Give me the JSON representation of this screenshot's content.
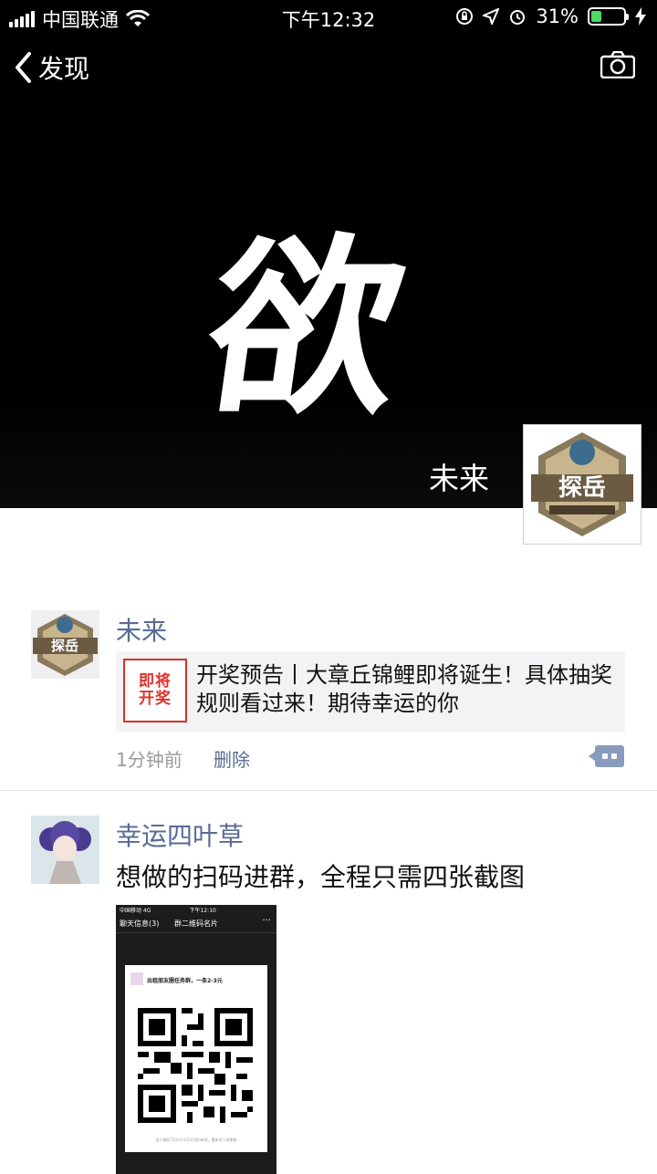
{
  "status_bar": {
    "carrier": "中国联通",
    "time": "下午12:32",
    "battery_pct": "31%",
    "battery_level": 0.31,
    "battery_color": "#4cd964"
  },
  "nav": {
    "back_label": "发现",
    "back_icon": "chevron-left-icon",
    "camera_icon": "camera-icon"
  },
  "cover": {
    "calligraphy": "欲",
    "user_name": "未来",
    "avatar_text": "探岳"
  },
  "posts": [
    {
      "author": "未来",
      "avatar_text": "探岳",
      "shared_link": {
        "thumb_text_1": "即将",
        "thumb_text_2": "开奖",
        "title": "开奖预告丨大章丘锦鲤即将诞生！具体抽奖规则看过来！期待幸运的你"
      },
      "time": "1分钟前",
      "delete_label": "删除"
    },
    {
      "author": "幸运四叶草",
      "text": "想做的扫码进群，全程只需四张截图",
      "image": {
        "status_left": "中国移动 4G",
        "status_time": "下午12:10",
        "nav_back": "聊天信息(3)",
        "nav_title": "群二维码名片",
        "nav_more": "···",
        "card_title": "出租朋友圈任务群，一条2-3元",
        "card_footer": "该二维码7天内(11月3日前)有效，重新进入将更新"
      }
    }
  ],
  "colors": {
    "link_blue": "#576b95",
    "meta_gray": "#999999",
    "link_bg": "#f3f3f5"
  }
}
